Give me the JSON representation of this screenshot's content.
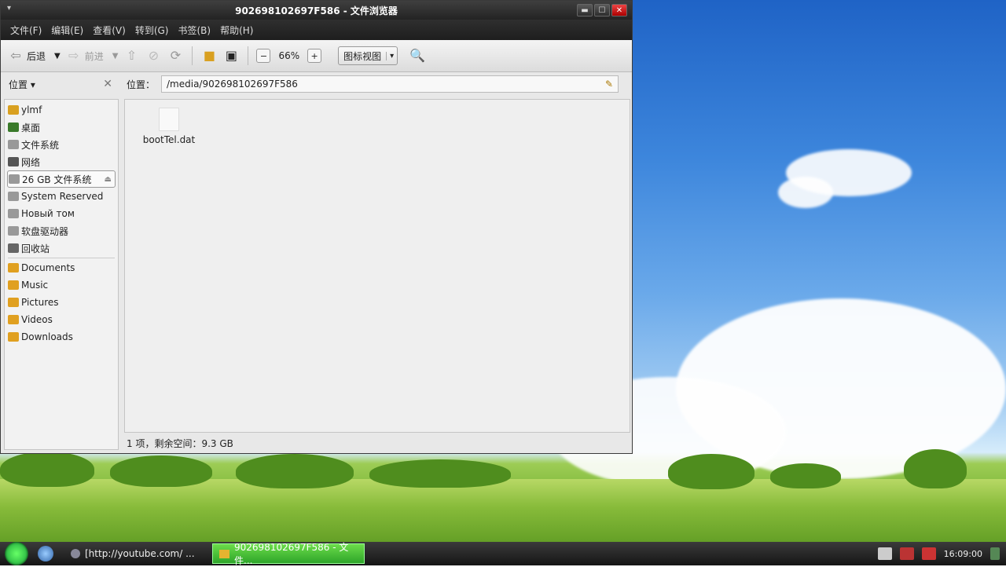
{
  "window": {
    "title": "902698102697F586 - 文件浏览器",
    "buttons": {
      "minimize": "▬",
      "maximize": "☐",
      "close": "✕"
    }
  },
  "menu": [
    "文件(F)",
    "编辑(E)",
    "查看(V)",
    "转到(G)",
    "书签(B)",
    "帮助(H)"
  ],
  "toolbar": {
    "back": "后退",
    "forward": "前进",
    "zoom": "66%",
    "view_mode": "图标视图"
  },
  "location": {
    "sidebar_title": "位置",
    "label": "位置：",
    "path": "/media/902698102697F586"
  },
  "sidebar": {
    "items": [
      {
        "label": "ylmf",
        "icon": "home-icon",
        "color": "#d9a020"
      },
      {
        "label": "桌面",
        "icon": "desktop-icon",
        "color": "#3a7a2a"
      },
      {
        "label": "文件系统",
        "icon": "drive-icon",
        "color": "#888888"
      },
      {
        "label": "网络",
        "icon": "network-icon",
        "color": "#555555"
      },
      {
        "label": "26 GB 文件系统",
        "icon": "drive-icon",
        "color": "#888888"
      },
      {
        "label": "System Reserved",
        "icon": "drive-icon",
        "color": "#888888"
      },
      {
        "label": "Новый том",
        "icon": "drive-icon",
        "color": "#888888"
      },
      {
        "label": "软盘驱动器",
        "icon": "floppy-icon",
        "color": "#888888"
      },
      {
        "label": "回收站",
        "icon": "trash-icon",
        "color": "#666666"
      }
    ],
    "bookmarks": [
      {
        "label": "Documents",
        "icon": "folder-documents-icon",
        "color": "#e0a020"
      },
      {
        "label": "Music",
        "icon": "folder-music-icon",
        "color": "#e0a020"
      },
      {
        "label": "Pictures",
        "icon": "folder-pictures-icon",
        "color": "#e0a020"
      },
      {
        "label": "Videos",
        "icon": "folder-videos-icon",
        "color": "#e0a020"
      },
      {
        "label": "Downloads",
        "icon": "folder-downloads-icon",
        "color": "#e0a020"
      }
    ]
  },
  "files": [
    {
      "name": "bootTel.dat",
      "icon": "document-icon"
    }
  ],
  "status": "1 项，剩余空间：9.3 GB",
  "taskbar": {
    "items": [
      {
        "label": "[http://youtube.com/ ...",
        "icon": "browser-icon"
      },
      {
        "label": "902698102697F586 - 文件...",
        "icon": "folder-icon",
        "active": true
      }
    ],
    "clock": "16:09:00"
  }
}
